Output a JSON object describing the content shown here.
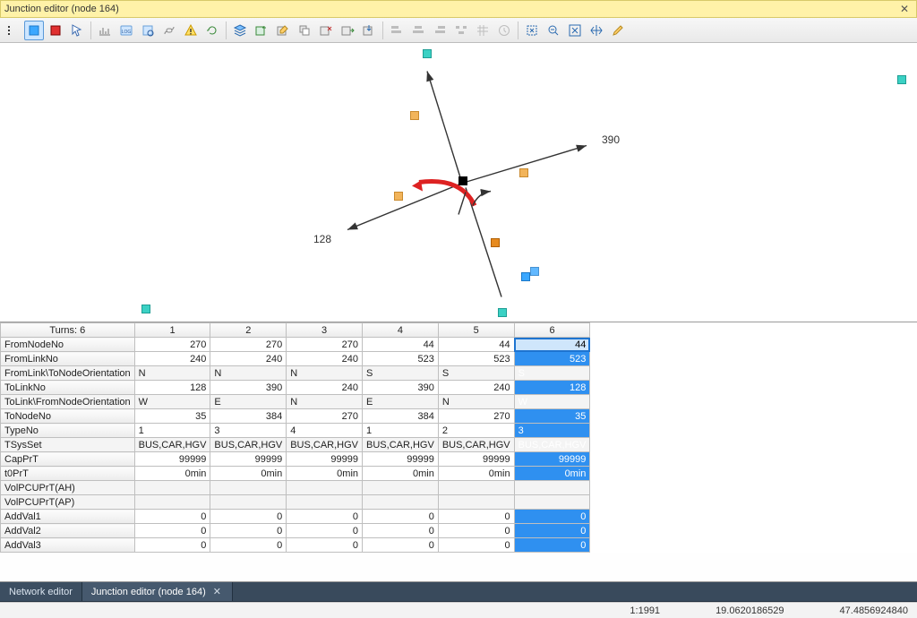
{
  "window": {
    "title": "Junction editor (node 164)"
  },
  "tabs": [
    {
      "label": "Network editor",
      "closeable": false
    },
    {
      "label": "Junction editor (node 164)",
      "closeable": true
    }
  ],
  "status": {
    "scale": "1:1991",
    "coord_x": "19.0620186529",
    "coord_y": "47.4856924840"
  },
  "diagram": {
    "labels": {
      "left": "128",
      "right": "390"
    }
  },
  "grid": {
    "corner": "Turns: 6",
    "col_headers": [
      "1",
      "2",
      "3",
      "4",
      "5",
      "6"
    ],
    "selected_col_index": 5,
    "rows": [
      {
        "name": "FromNodeNo",
        "align": "right",
        "cells": [
          "270",
          "270",
          "270",
          "44",
          "44",
          "44"
        ]
      },
      {
        "name": "FromLinkNo",
        "align": "right",
        "cells": [
          "240",
          "240",
          "240",
          "523",
          "523",
          "523"
        ]
      },
      {
        "name": "FromLink\\ToNodeOrientation",
        "align": "left",
        "cells": [
          "N",
          "N",
          "N",
          "S",
          "S",
          "S"
        ]
      },
      {
        "name": "ToLinkNo",
        "align": "right",
        "cells": [
          "128",
          "390",
          "240",
          "390",
          "240",
          "128"
        ]
      },
      {
        "name": "ToLink\\FromNodeOrientation",
        "align": "left",
        "cells": [
          "W",
          "E",
          "N",
          "E",
          "N",
          "W"
        ]
      },
      {
        "name": "ToNodeNo",
        "align": "right",
        "cells": [
          "35",
          "384",
          "270",
          "384",
          "270",
          "35"
        ]
      },
      {
        "name": "TypeNo",
        "align": "left",
        "cells": [
          "1",
          "3",
          "4",
          "1",
          "2",
          "3"
        ]
      },
      {
        "name": "TSysSet",
        "align": "left",
        "cells": [
          "BUS,CAR,HGV",
          "BUS,CAR,HGV",
          "BUS,CAR,HGV",
          "BUS,CAR,HGV",
          "BUS,CAR,HGV",
          "BUS,CAR,HGV"
        ]
      },
      {
        "name": "CapPrT",
        "align": "right",
        "cells": [
          "99999",
          "99999",
          "99999",
          "99999",
          "99999",
          "99999"
        ]
      },
      {
        "name": "t0PrT",
        "align": "right",
        "cells": [
          "0min",
          "0min",
          "0min",
          "0min",
          "0min",
          "0min"
        ]
      },
      {
        "name": "VolPCUPrT(AH)",
        "align": "right",
        "cells": [
          "",
          "",
          "",
          "",
          "",
          ""
        ]
      },
      {
        "name": "VolPCUPrT(AP)",
        "align": "right",
        "cells": [
          "",
          "",
          "",
          "",
          "",
          ""
        ]
      },
      {
        "name": "AddVal1",
        "align": "right",
        "cells": [
          "0",
          "0",
          "0",
          "0",
          "0",
          "0"
        ]
      },
      {
        "name": "AddVal2",
        "align": "right",
        "cells": [
          "0",
          "0",
          "0",
          "0",
          "0",
          "0"
        ]
      },
      {
        "name": "AddVal3",
        "align": "right",
        "cells": [
          "0",
          "0",
          "0",
          "0",
          "0",
          "0"
        ]
      }
    ]
  }
}
